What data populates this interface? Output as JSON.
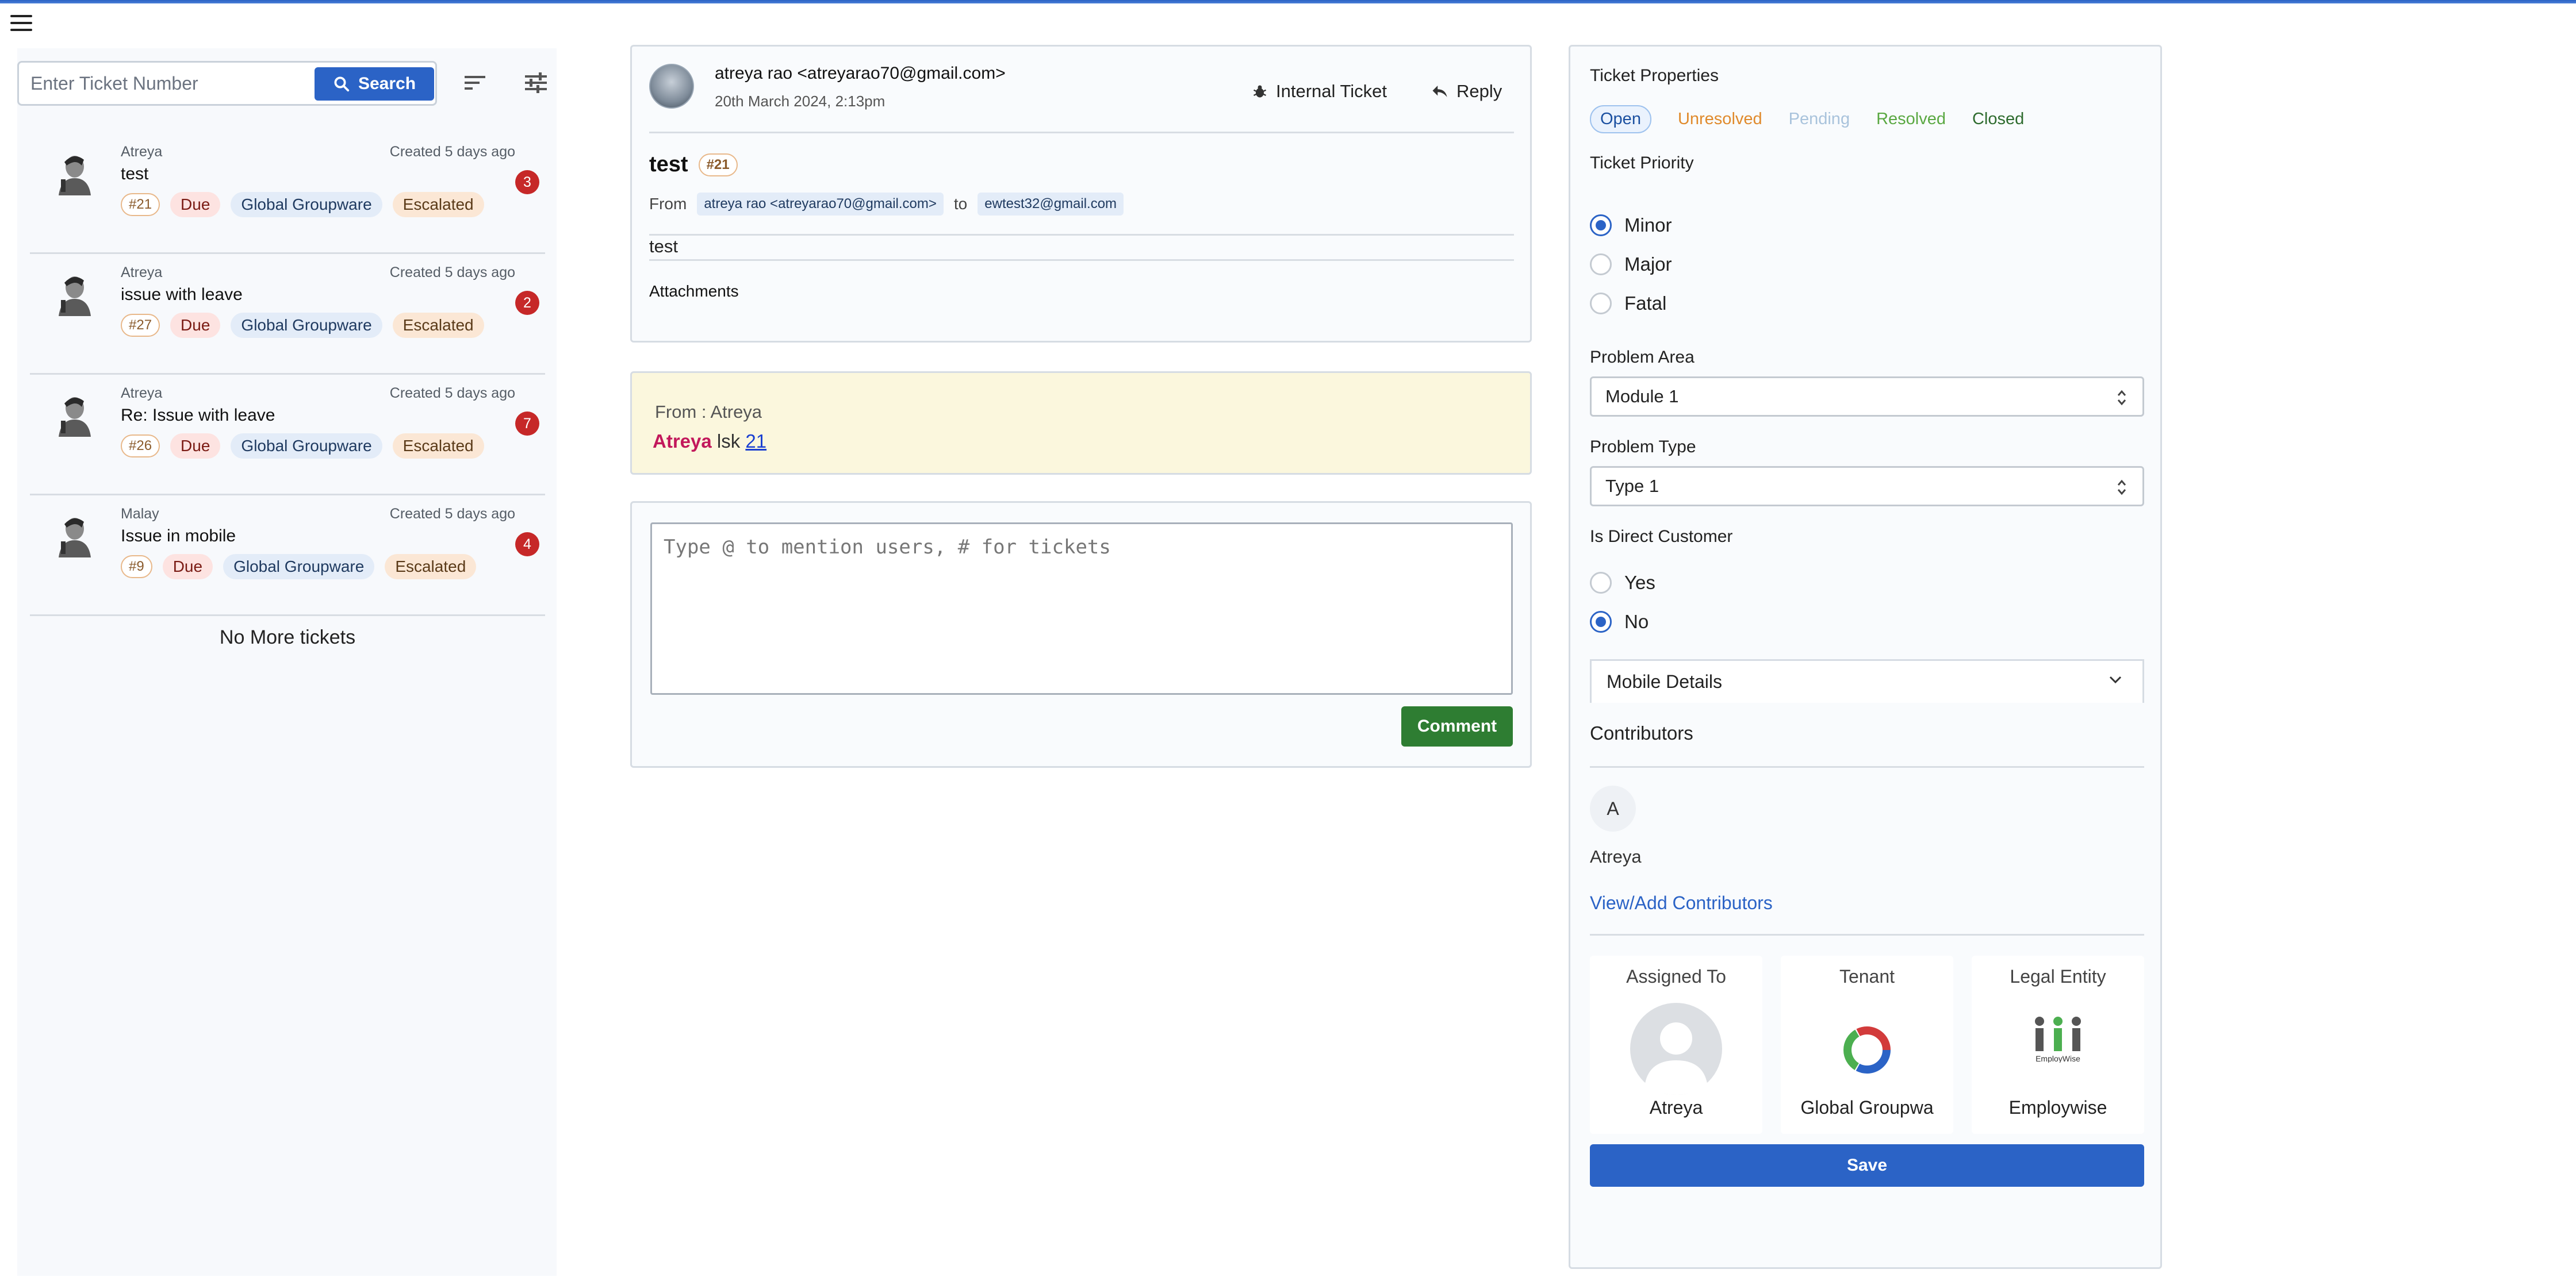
{
  "nav": {
    "menu_icon": "hamburger-menu-icon"
  },
  "search": {
    "placeholder": "Enter Ticket Number",
    "button_label": "Search"
  },
  "toolbar": {
    "sort_icon": "sort-icon",
    "filter_icon": "tune-filter-icon"
  },
  "tickets": [
    {
      "author": "Atreya",
      "created": "Created 5 days ago",
      "subject": "test",
      "count": "3",
      "number": "#21",
      "due": "Due",
      "group": "Global Groupware",
      "status": "Escalated"
    },
    {
      "author": "Atreya",
      "created": "Created 5 days ago",
      "subject": "issue with leave",
      "count": "2",
      "number": "#27",
      "due": "Due",
      "group": "Global Groupware",
      "status": "Escalated"
    },
    {
      "author": "Atreya",
      "created": "Created 5 days ago",
      "subject": "Re: Issue with leave",
      "count": "7",
      "number": "#26",
      "due": "Due",
      "group": "Global Groupware",
      "status": "Escalated"
    },
    {
      "author": "Malay",
      "created": "Created 5 days ago",
      "subject": "Issue in mobile",
      "count": "4",
      "number": "#9",
      "due": "Due",
      "group": "Global Groupware",
      "status": "Escalated"
    }
  ],
  "no_more": "No More tickets",
  "email": {
    "sender": "atreya rao <atreyarao70@gmail.com>",
    "date": "20th March 2024, 2:13pm",
    "internal_label": "Internal Ticket",
    "reply_label": "Reply",
    "subject": "test",
    "number": "#21",
    "from_label": "From",
    "from_value": "atreya rao <atreyarao70@gmail.com>",
    "to_label": "to",
    "to_value": "ewtest32@gmail.com",
    "body": "test",
    "attachments_label": "Attachments"
  },
  "note": {
    "from": "From : Atreya",
    "author": "Atreya",
    "text": " lsk ",
    "link": "21"
  },
  "comment": {
    "placeholder": "Type @ to mention users, # for tickets",
    "button_label": "Comment"
  },
  "properties": {
    "title": "Ticket Properties",
    "statuses": [
      {
        "label": "Open",
        "color": "#1a4fa0"
      },
      {
        "label": "Unresolved",
        "color": "#e08a2c"
      },
      {
        "label": "Pending",
        "color": "#a9c3dc"
      },
      {
        "label": "Resolved",
        "color": "#5aa842"
      },
      {
        "label": "Closed",
        "color": "#2e6b2e"
      }
    ],
    "priority_label": "Ticket Priority",
    "priorities": [
      "Minor",
      "Major",
      "Fatal"
    ],
    "priority_selected": "Minor",
    "problem_area_label": "Problem Area",
    "problem_area_value": "Module 1",
    "problem_type_label": "Problem Type",
    "problem_type_value": "Type 1",
    "direct_customer_label": "Is Direct Customer",
    "direct_options": [
      "Yes",
      "No"
    ],
    "direct_selected": "No",
    "mobile_details_label": "Mobile Details",
    "contributors_label": "Contributors",
    "contributor_initial": "A",
    "contributor_name": "Atreya",
    "view_add_label": "View/Add Contributors",
    "assigned_label": "Assigned To",
    "assigned_value": "Atreya",
    "tenant_label": "Tenant",
    "tenant_value": "Global Groupwa",
    "legal_label": "Legal Entity",
    "legal_value": "Employwise",
    "legal_logo_text": "EmployWise",
    "save_label": "Save"
  }
}
